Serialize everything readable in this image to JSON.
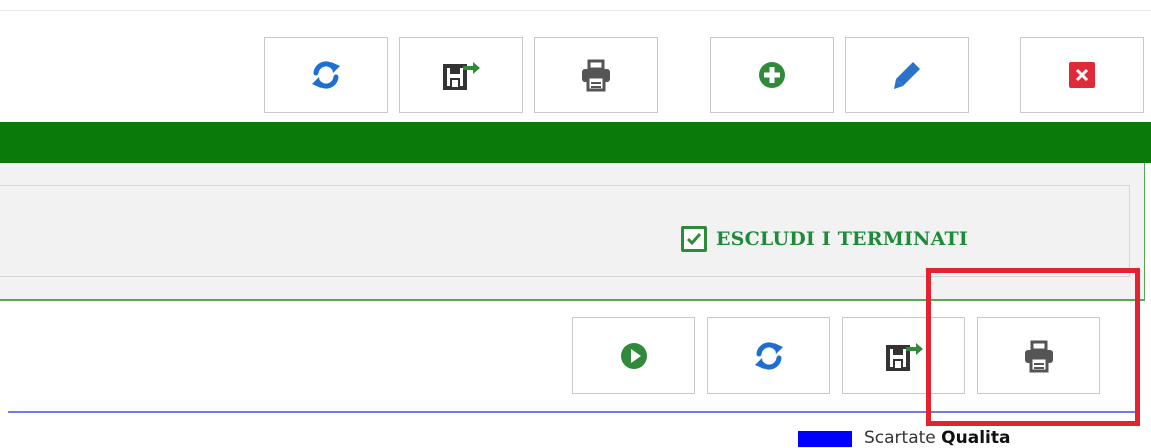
{
  "toolbar_top": {
    "buttons": [
      {
        "name": "refresh-button",
        "icon": "refresh-icon",
        "color": "#1f6fd1"
      },
      {
        "name": "export-button",
        "icon": "export-icon",
        "color": "#333333"
      },
      {
        "name": "print-button",
        "icon": "printer-icon",
        "color": "#555555"
      },
      {
        "name": "add-button",
        "icon": "plus-circle-icon",
        "color": "#2f8a3a"
      },
      {
        "name": "edit-button",
        "icon": "pencil-icon",
        "color": "#2a73c9"
      },
      {
        "name": "close-button",
        "icon": "close-icon",
        "color": "#e02a3a"
      }
    ]
  },
  "header": {
    "bar_color": "#0a7b0a"
  },
  "filters": {
    "exclude_terminated": {
      "label": "ESCLUDI I TERMINATI",
      "checked": true
    }
  },
  "toolbar_bottom": {
    "buttons": [
      {
        "name": "start-button",
        "icon": "play-circle-icon",
        "color": "#2f8a3a"
      },
      {
        "name": "refresh-button",
        "icon": "refresh-icon",
        "color": "#1f6fd1"
      },
      {
        "name": "export-button",
        "icon": "export-icon",
        "color": "#333333"
      },
      {
        "name": "print-button",
        "icon": "printer-icon",
        "color": "#555555",
        "highlighted": true
      }
    ]
  },
  "legend": {
    "swatch_color": "#0000ff",
    "label_prefix": "Scartate",
    "label_bold": "Qualita"
  }
}
